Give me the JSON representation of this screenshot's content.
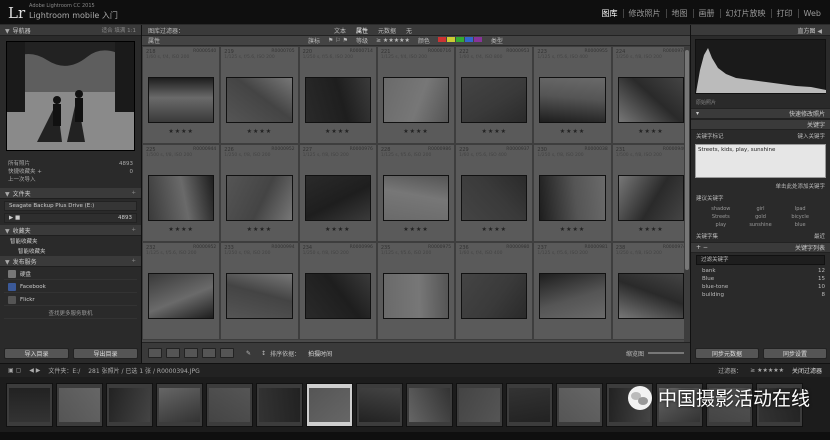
{
  "identity": {
    "small": "Adobe Lightroom CC 2015",
    "title": "Lightroom mobile 入门"
  },
  "modules": [
    "图库",
    "修改照片",
    "地图",
    "画册",
    "幻灯片放映",
    "打印",
    "Web"
  ],
  "left_panel": {
    "navigator": "导航器",
    "navigator_opts": "适合  填满  1:1",
    "catalog_rows": [
      {
        "label": "所有照片",
        "count": "4893"
      },
      {
        "label": "快捷收藏夹 +",
        "count": "0"
      },
      {
        "label": "上一次导入",
        "count": ""
      }
    ],
    "folders_title": "文件夹",
    "folder_name": "Seagate Backup Plus Drive (E:)",
    "folder_count": "4893",
    "collections_title": "收藏夹",
    "collections": [
      "智能收藏夹",
      "智能收藏夹"
    ],
    "publish_title": "发布服务",
    "publish": [
      "硬盘",
      "Facebook",
      "Flickr"
    ],
    "publish_more": "查找更多服务联机",
    "import_btn": "导入目录",
    "export_btn": "导出目录"
  },
  "center": {
    "filter_label": "图库过滤器：",
    "filter_tabs": [
      "文本",
      "属性",
      "元数据",
      "无"
    ],
    "filter_active": "属性",
    "attr_label": "属性",
    "attr_flag": "旗标",
    "attr_rating": "等级",
    "attr_color": "颜色",
    "attr_kind": "类型",
    "grid_cells": [
      {
        "num": "218",
        "file": "R0000540",
        "meta": "1/60 s, f/4, ISO 200",
        "stars": "★★★★"
      },
      {
        "num": "219",
        "file": "R0000705",
        "meta": "1/125 s, f/5.6, ISO 200",
        "stars": "★★★★"
      },
      {
        "num": "220",
        "file": "R0000714",
        "meta": "1/250 s, f/5.6, ISO 200",
        "stars": "★★★★"
      },
      {
        "num": "221",
        "file": "R0000716",
        "meta": "1/125 s, f/4, ISO 200",
        "stars": "★★★★"
      },
      {
        "num": "222",
        "file": "R0000953",
        "meta": "1/60 s, f/4, ISO 800",
        "stars": "★★★★"
      },
      {
        "num": "223",
        "file": "R0000955",
        "meta": "1/125 s, f/5.6, ISO 400",
        "stars": "★★★★"
      },
      {
        "num": "224",
        "file": "R0000974",
        "meta": "1/250 s, f/8, ISO 200",
        "stars": "★★★★"
      },
      {
        "num": "225",
        "file": "R0000944",
        "meta": "1/500 s, f/8, ISO 200",
        "stars": "★★★★"
      },
      {
        "num": "226",
        "file": "R0000952",
        "meta": "1/250 s, f/8, ISO 200",
        "stars": "★★★★"
      },
      {
        "num": "227",
        "file": "R0000976",
        "meta": "1/125 s, f/8, ISO 200",
        "stars": "★★★★"
      },
      {
        "num": "228",
        "file": "R0000986",
        "meta": "1/125 s, f/5.6, ISO 200",
        "stars": "★★★★"
      },
      {
        "num": "229",
        "file": "R0000937",
        "meta": "1/60 s, f/5.6, ISO 400",
        "stars": "★★★★"
      },
      {
        "num": "230",
        "file": "R0000038",
        "meta": "1/250 s, f/8, ISO 200",
        "stars": "★★★★"
      },
      {
        "num": "231",
        "file": "R0000940",
        "meta": "1/500 s, f/8, ISO 200",
        "stars": "★★★★"
      },
      {
        "num": "232",
        "file": "R0000952",
        "meta": "1/125 s, f/5.6, ISO 200",
        "stars": ""
      },
      {
        "num": "233",
        "file": "R0000994",
        "meta": "1/250 s, f/8, ISO 200",
        "stars": ""
      },
      {
        "num": "234",
        "file": "R0000996",
        "meta": "1/250 s, f/8, ISO 200",
        "stars": ""
      },
      {
        "num": "235",
        "file": "R0000975",
        "meta": "1/125 s, f/5.6, ISO 200",
        "stars": ""
      },
      {
        "num": "236",
        "file": "R0000980",
        "meta": "1/60 s, f/4, ISO 400",
        "stars": ""
      },
      {
        "num": "237",
        "file": "R0000981",
        "meta": "1/125 s, f/5.6, ISO 200",
        "stars": ""
      },
      {
        "num": "238",
        "file": "R0000974",
        "meta": "1/250 s, f/8, ISO 200",
        "stars": ""
      }
    ],
    "sort_label": "排序依据：",
    "sort_value": "拍摄时间",
    "thumb_label": "缩览图"
  },
  "right_panel": {
    "histogram": "直方图",
    "hist_info": "原始照片",
    "quick_develop": "快速修改照片",
    "keywording": "关键字",
    "keyword_tags_label": "关键字标记",
    "keyword_tags_value": "键入关键字",
    "keywords_text": "Streets, kids, play, sunshine",
    "click_add": "单击此处添加关键字",
    "suggestions": "建议关键字",
    "suggestion_items": [
      "shadow",
      "girl",
      "Ipad",
      "Streets",
      "gold",
      "bicycle",
      "play",
      "sunshine",
      "blue"
    ],
    "keyword_set": "关键字集",
    "keyword_set_value": "最近",
    "keyword_list": "关键字列表",
    "filter_keywords": "过滤关键字",
    "list_items": [
      {
        "label": "bank",
        "count": "12"
      },
      {
        "label": "Blue",
        "count": "15"
      },
      {
        "label": "blue-tone",
        "count": "10"
      },
      {
        "label": "building",
        "count": "8"
      }
    ],
    "sync_meta": "同步元数据",
    "sync_settings": "同步设置"
  },
  "filmbar": {
    "left": "文件夹：E:/",
    "info": "281 张照片 / 已选 1 张 / R0000394.JPG",
    "filter_label": "过滤器：",
    "filter_off": "关闭过滤器"
  },
  "watermark": "中国摄影活动在线"
}
